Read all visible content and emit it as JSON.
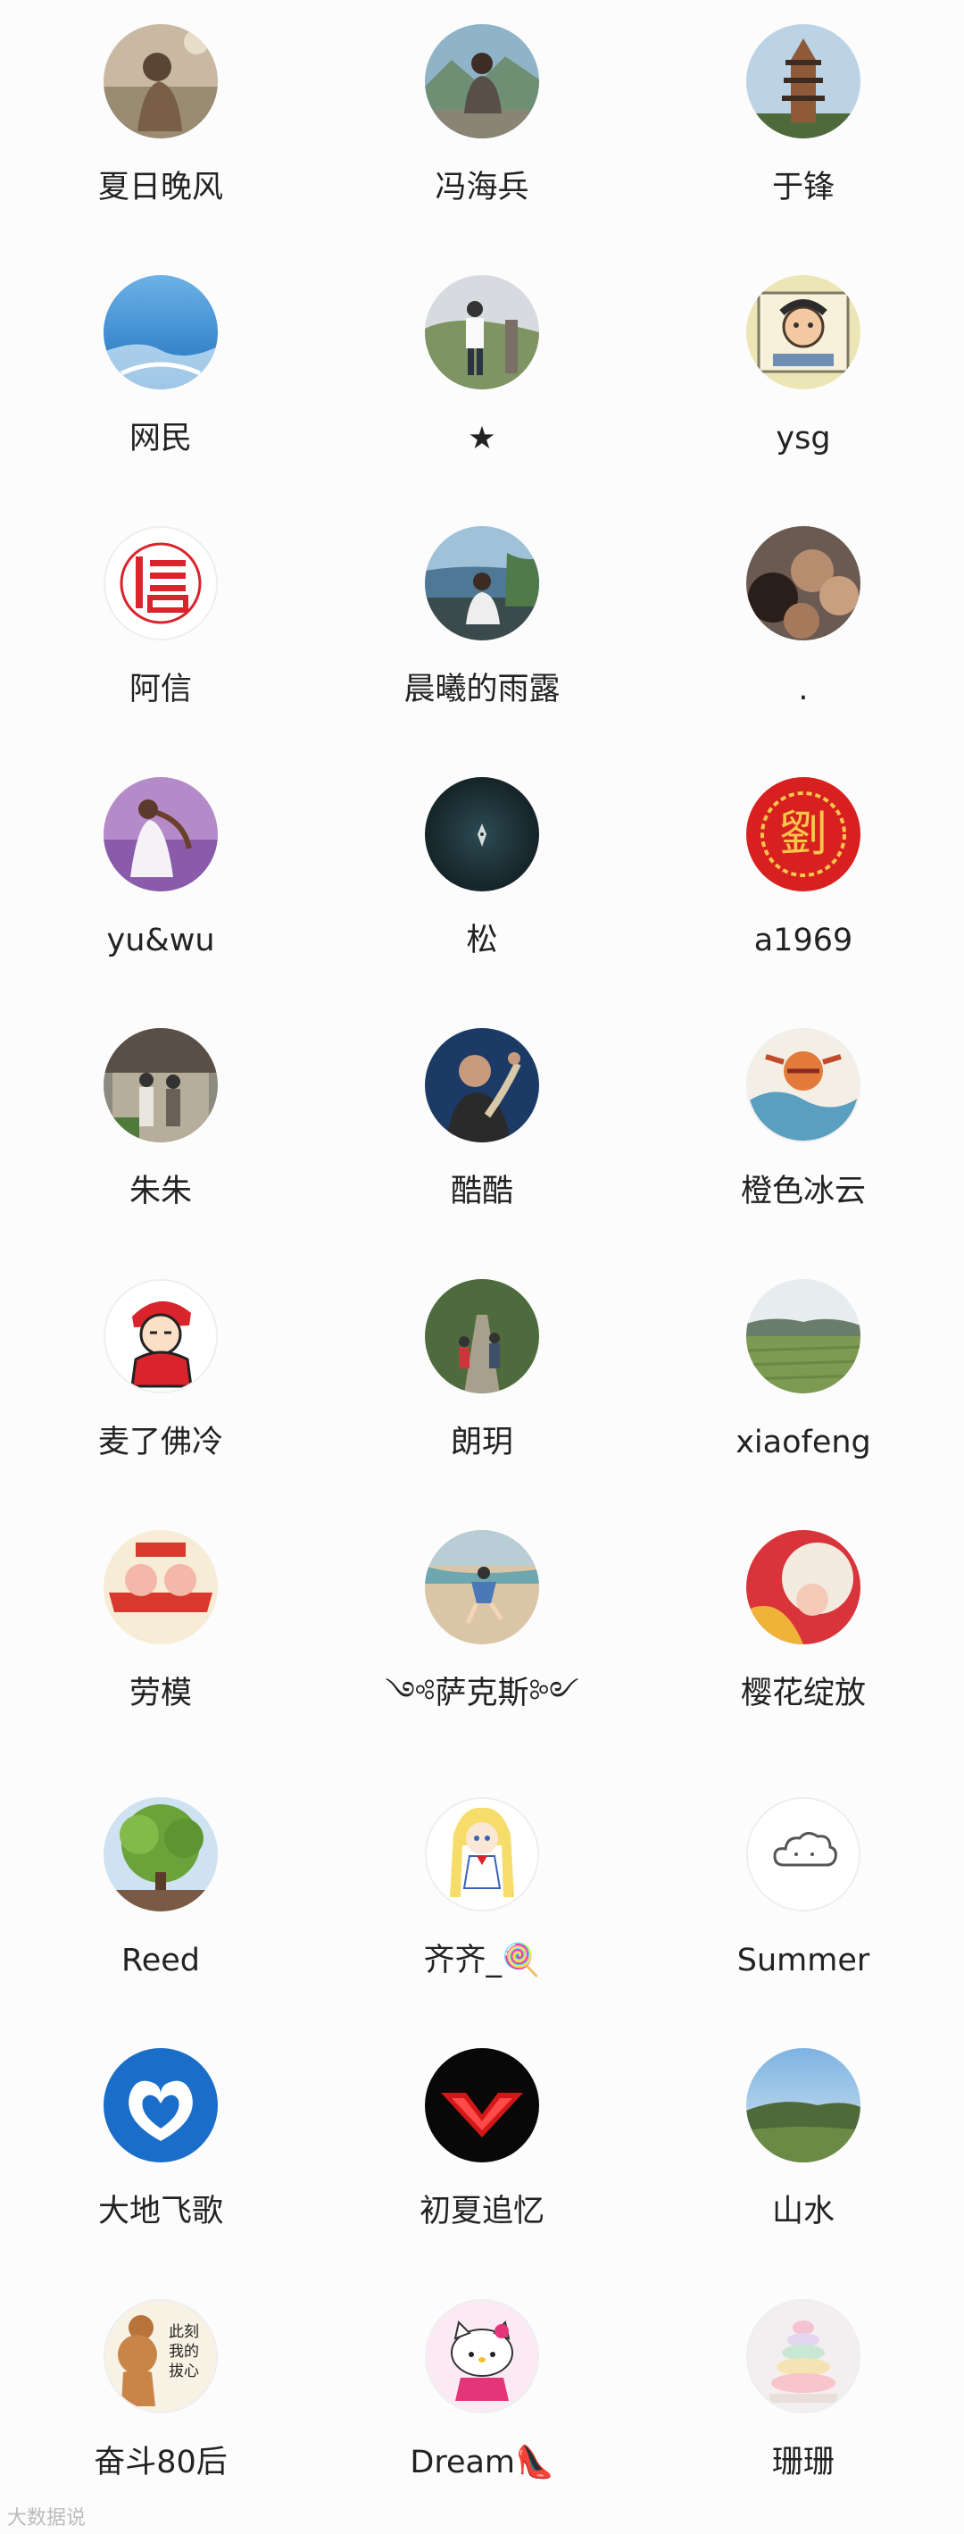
{
  "contacts": [
    {
      "name": "夏日晚风",
      "avatar": "person-sitting-avatar"
    },
    {
      "name": "冯海兵",
      "avatar": "man-on-rocks-avatar"
    },
    {
      "name": "于锋",
      "avatar": "pagoda-avatar"
    },
    {
      "name": "网民",
      "avatar": "blue-landscape-avatar"
    },
    {
      "name": "★",
      "avatar": "man-standing-avatar"
    },
    {
      "name": "ysg",
      "avatar": "cartoon-drawing-avatar"
    },
    {
      "name": "阿信",
      "avatar": "red-xin-logo-avatar"
    },
    {
      "name": "晨曦的雨露",
      "avatar": "man-at-sea-avatar"
    },
    {
      "name": ".",
      "avatar": "group-photo-avatar"
    },
    {
      "name": "yu&wu",
      "avatar": "lavender-field-avatar"
    },
    {
      "name": "松",
      "avatar": "boat-on-dark-water-avatar"
    },
    {
      "name": "a1969",
      "avatar": "red-liu-seal-avatar"
    },
    {
      "name": "朱朱",
      "avatar": "elderly-couple-avatar"
    },
    {
      "name": "酷酷",
      "avatar": "performer-avatar"
    },
    {
      "name": "橙色冰云",
      "avatar": "folk-painting-avatar"
    },
    {
      "name": "麦了佛冷",
      "avatar": "red-cartoon-boy-avatar"
    },
    {
      "name": "朗玥",
      "avatar": "forest-path-avatar"
    },
    {
      "name": "xiaofeng",
      "avatar": "green-field-avatar"
    },
    {
      "name": "劳模",
      "avatar": "cartoon-pig-avatar"
    },
    {
      "name": "༺萨克斯༻",
      "avatar": "beach-jump-avatar"
    },
    {
      "name": "樱花绽放",
      "avatar": "red-illustration-avatar"
    },
    {
      "name": "Reed",
      "avatar": "big-tree-avatar"
    },
    {
      "name": "齐齐_🍭",
      "avatar": "sailor-moon-avatar"
    },
    {
      "name": "Summer",
      "avatar": "cloud-avatar"
    },
    {
      "name": "大地飞歌",
      "avatar": "heart-cloud-avatar"
    },
    {
      "name": "初夏追忆",
      "avatar": "red-v-logo-avatar"
    },
    {
      "name": "山水",
      "avatar": "hill-landscape-avatar"
    },
    {
      "name": "奋斗80后",
      "avatar": "jerry-mouse-avatar"
    },
    {
      "name": "Dream👠",
      "avatar": "hello-kitty-avatar"
    },
    {
      "name": "珊珊",
      "avatar": "macaron-tower-avatar"
    }
  ],
  "watermark": "大数据说"
}
